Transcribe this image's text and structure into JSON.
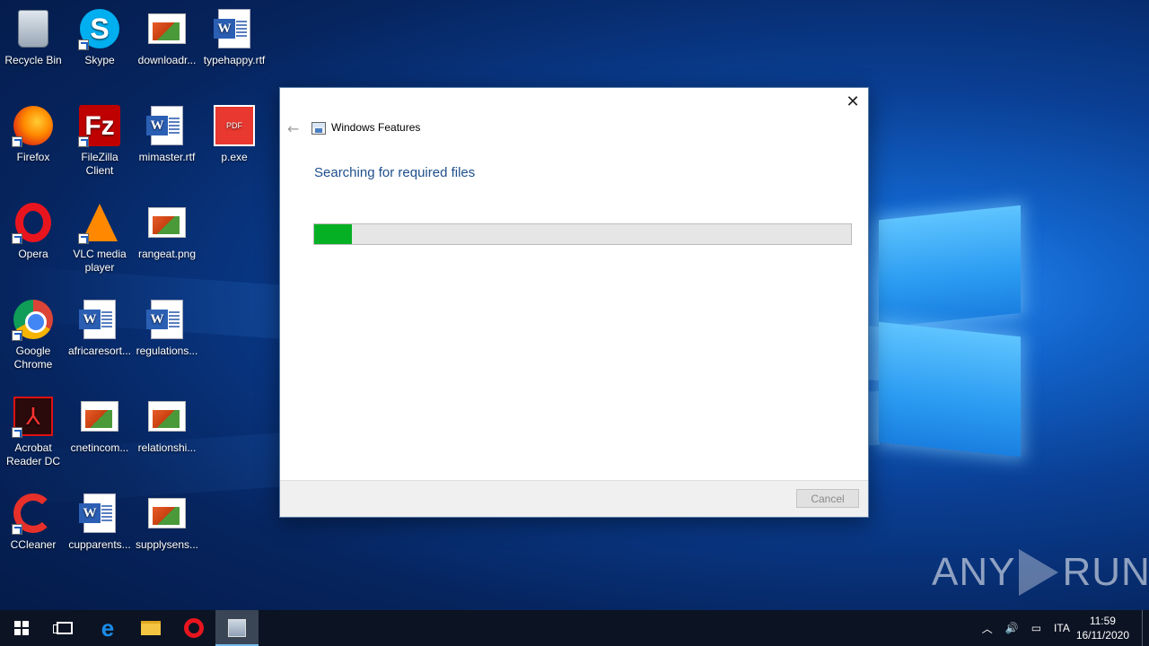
{
  "desktop": {
    "icons": [
      {
        "label": "Recycle Bin",
        "icon": "recycle-bin-icon"
      },
      {
        "label": "Skype",
        "icon": "skype-icon"
      },
      {
        "label": "downloadr...",
        "icon": "image-file-icon"
      },
      {
        "label": "typehappy.rtf",
        "icon": "word-document-icon"
      },
      {
        "label": "Firefox",
        "icon": "firefox-icon"
      },
      {
        "label": "FileZilla Client",
        "icon": "filezilla-icon"
      },
      {
        "label": "mimaster.rtf",
        "icon": "word-document-icon"
      },
      {
        "label": "p.exe",
        "icon": "pdf-icon"
      },
      {
        "label": "Opera",
        "icon": "opera-icon"
      },
      {
        "label": "VLC media player",
        "icon": "vlc-icon"
      },
      {
        "label": "rangeat.png",
        "icon": "image-file-icon"
      },
      {
        "label": "Google Chrome",
        "icon": "chrome-icon"
      },
      {
        "label": "africaresort...",
        "icon": "word-document-icon"
      },
      {
        "label": "regulations...",
        "icon": "word-document-icon"
      },
      {
        "label": "Acrobat Reader DC",
        "icon": "acrobat-icon"
      },
      {
        "label": "cnetincom...",
        "icon": "image-file-icon"
      },
      {
        "label": "relationshi...",
        "icon": "image-file-icon"
      },
      {
        "label": "CCleaner",
        "icon": "ccleaner-icon"
      },
      {
        "label": "cupparents...",
        "icon": "word-document-icon"
      },
      {
        "label": "supplysens...",
        "icon": "image-file-icon"
      }
    ]
  },
  "dialog": {
    "title": "Windows Features",
    "heading": "Searching for required files",
    "progress_percent": 7,
    "cancel_label": "Cancel",
    "close_glyph": "✕",
    "back_glyph": "←"
  },
  "watermark": {
    "left": "ANY",
    "right": "RUN"
  },
  "taskbar": {
    "language": "ITA",
    "time": "11:59",
    "date": "16/11/2020"
  },
  "colors": {
    "progress_fill": "#06b025",
    "heading": "#1e4f8c",
    "taskbar": "#0c1322"
  }
}
